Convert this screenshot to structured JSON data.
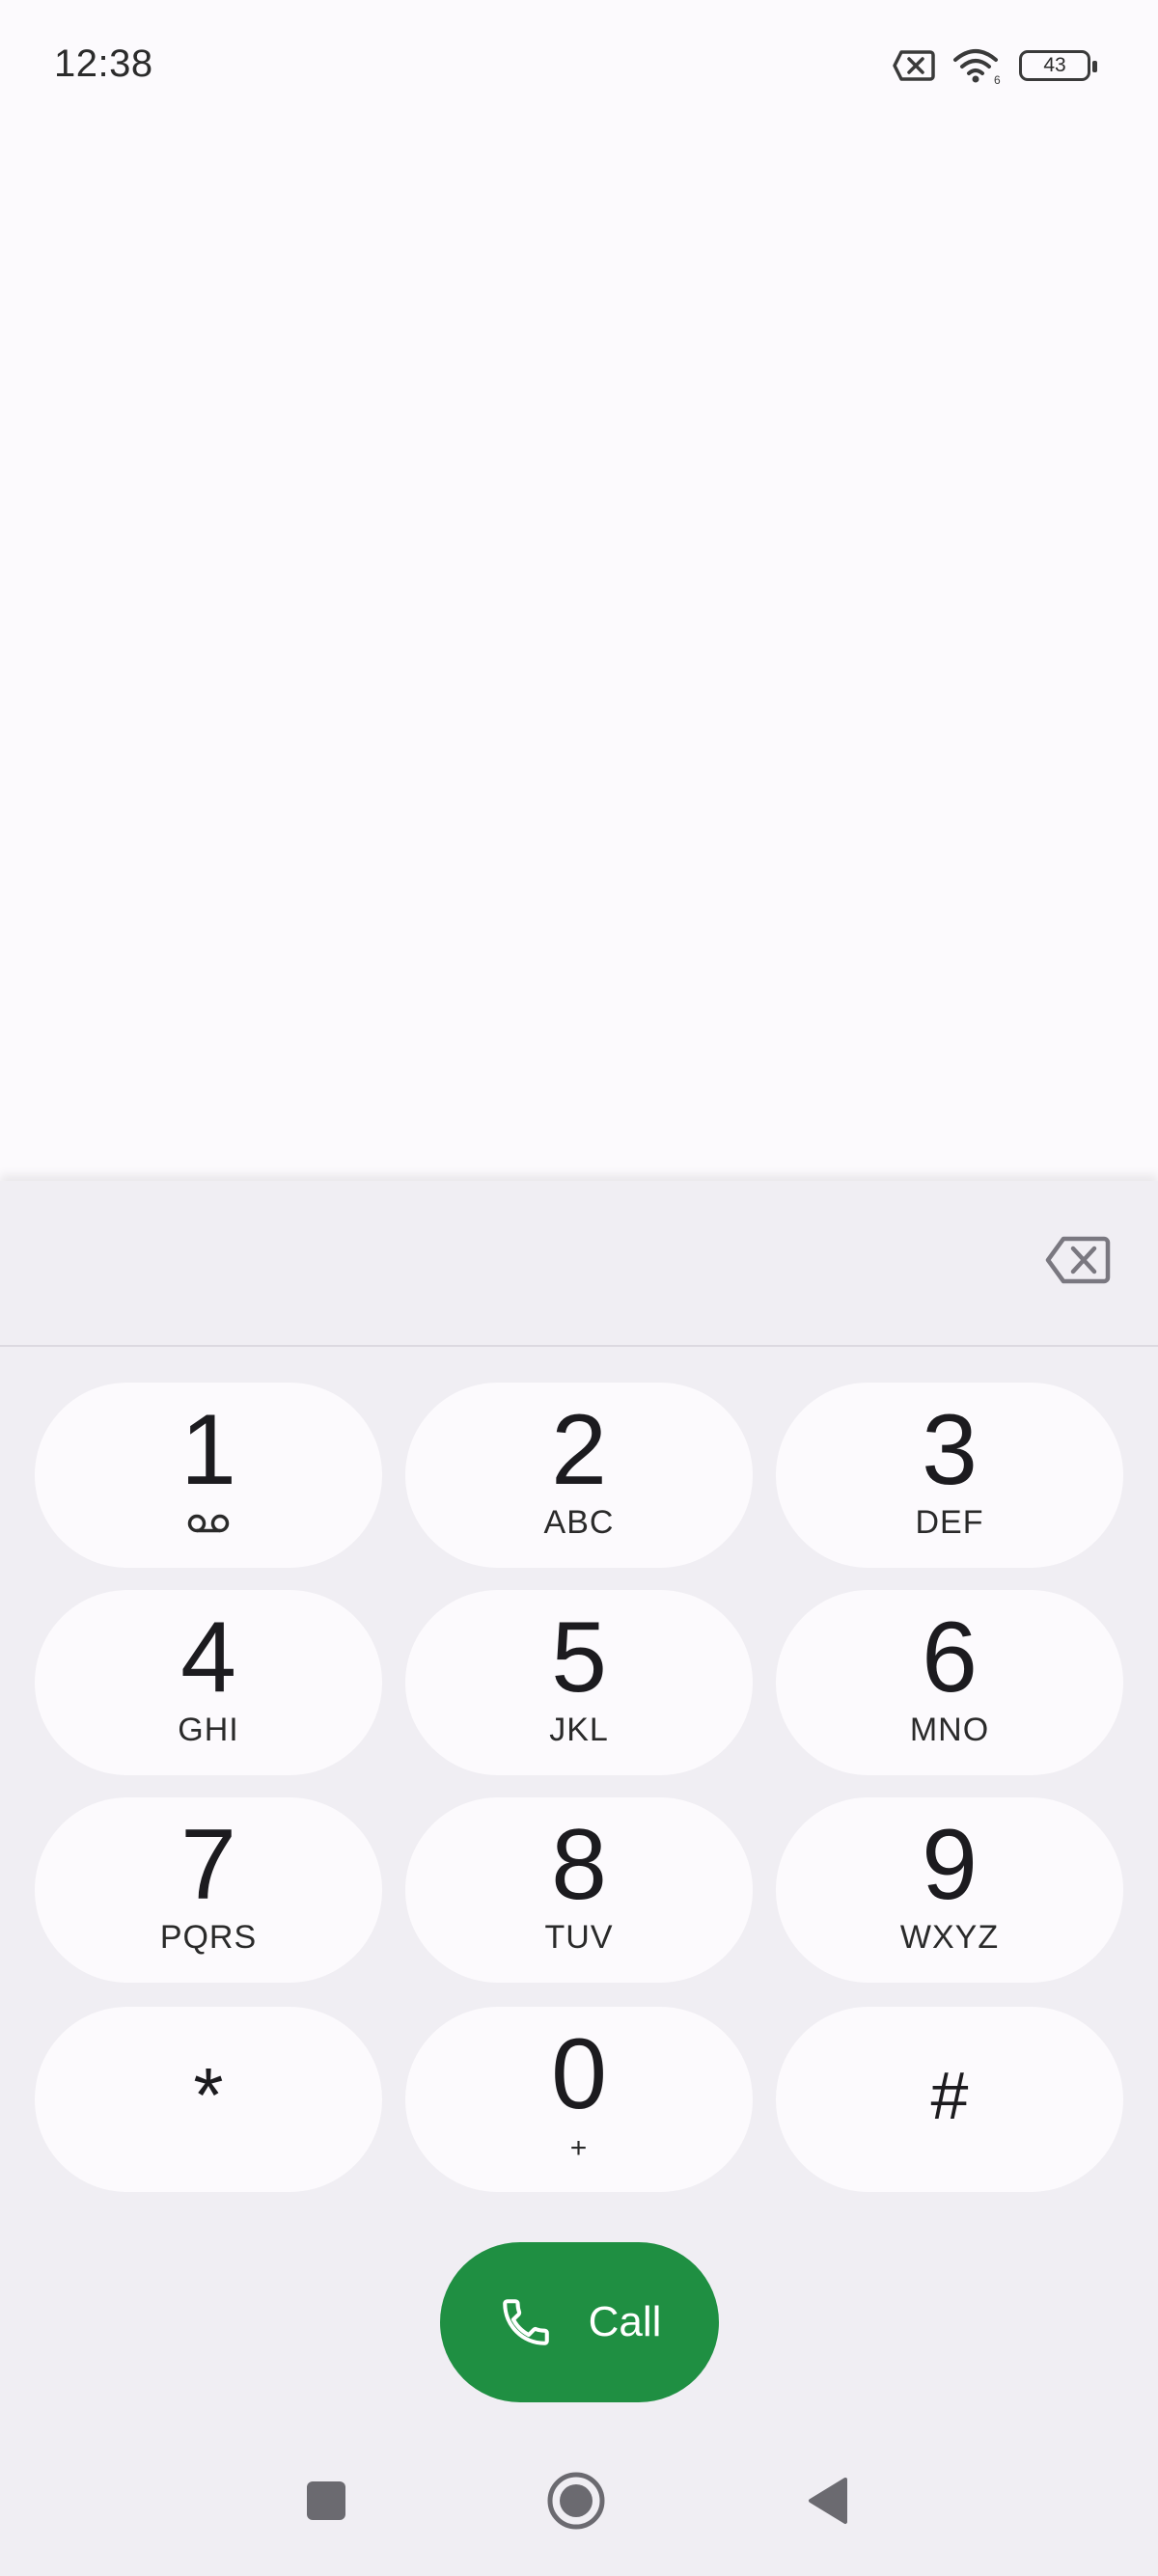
{
  "status_bar": {
    "time": "12:38",
    "battery_level": "43",
    "icons": [
      "sim-error-icon",
      "wifi-icon",
      "battery-icon"
    ]
  },
  "dialer": {
    "number_value": "",
    "keys": [
      {
        "digit": "1",
        "letters": "",
        "icon": "voicemail-icon"
      },
      {
        "digit": "2",
        "letters": "ABC"
      },
      {
        "digit": "3",
        "letters": "DEF"
      },
      {
        "digit": "4",
        "letters": "GHI"
      },
      {
        "digit": "5",
        "letters": "JKL"
      },
      {
        "digit": "6",
        "letters": "MNO"
      },
      {
        "digit": "7",
        "letters": "PQRS"
      },
      {
        "digit": "8",
        "letters": "TUV"
      },
      {
        "digit": "9",
        "letters": "WXYZ"
      },
      {
        "digit": "*",
        "letters": ""
      },
      {
        "digit": "0",
        "letters": "+"
      },
      {
        "digit": "#",
        "letters": ""
      }
    ],
    "call_label": "Call"
  },
  "colors": {
    "call_green": "#1f8f42",
    "panel_bg": "#f0eef3",
    "key_bg": "#fcfafd"
  },
  "nav_bar": {
    "buttons": [
      "recents-square-icon",
      "home-circle-icon",
      "back-triangle-icon"
    ]
  }
}
